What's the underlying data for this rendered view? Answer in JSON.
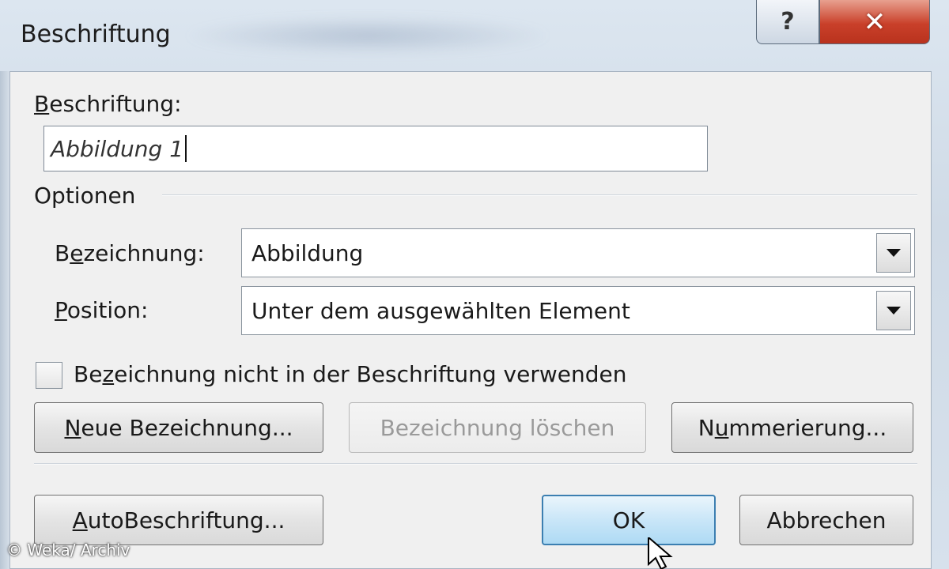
{
  "window": {
    "title": "Beschriftung",
    "help_glyph": "?",
    "close_glyph": "✕"
  },
  "caption": {
    "label_first": "B",
    "label_rest": "eschriftung:",
    "value": "Abbildung 1"
  },
  "options": {
    "group_label": "Optionen",
    "bezeichnung": {
      "label_a": "B",
      "label_u": "e",
      "label_b": "zeichnung:",
      "value": "Abbildung"
    },
    "position": {
      "label_u": "P",
      "label_rest": "osition:",
      "value": "Unter dem ausgewählten Element"
    },
    "exclude_checkbox": {
      "label_a": "Be",
      "label_u": "z",
      "label_b": "eichnung nicht in der Beschriftung verwenden",
      "checked": false
    }
  },
  "buttons": {
    "new_label_u": "N",
    "new_label_rest": "eue Bezeichnung...",
    "delete_label": "Bezeichnung löschen",
    "numbering_a": "N",
    "numbering_u": "u",
    "numbering_b": "mmerierung...",
    "autocaption_u": "A",
    "autocaption_rest": "utoBeschriftung...",
    "ok": "OK",
    "cancel": "Abbrechen"
  },
  "watermark": "© Weka/ Archiv",
  "colors": {
    "close_button": "#c9402a",
    "default_button_border": "#3c7fb1",
    "dialog_bg": "#f0f0f0"
  }
}
